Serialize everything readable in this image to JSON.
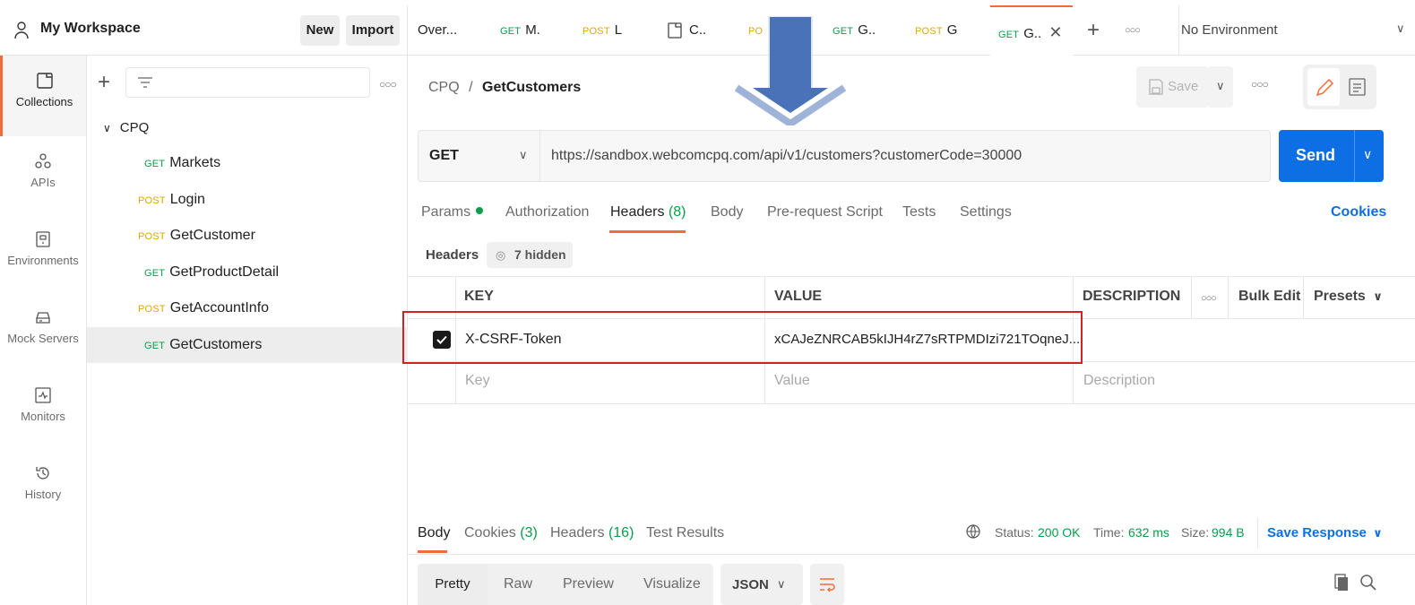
{
  "colors": {
    "accent": "#f26b3a",
    "get": "#0a9d4a",
    "post": "#e0a800",
    "primary": "#0d6fe3",
    "annotation_red": "#d32222",
    "annotation_arrow": "#4a72b8"
  },
  "workspace": {
    "title": "My Workspace",
    "new_label": "New",
    "import_label": "Import",
    "icon": "user-icon"
  },
  "left_nav": [
    {
      "label": "Collections",
      "icon": "collections-icon"
    },
    {
      "label": "APIs",
      "icon": "apis-icon"
    },
    {
      "label": "Environments",
      "icon": "environments-icon"
    },
    {
      "label": "Mock Servers",
      "icon": "mock-servers-icon"
    },
    {
      "label": "Monitors",
      "icon": "monitors-icon"
    },
    {
      "label": "History",
      "icon": "history-icon"
    }
  ],
  "sidebar": {
    "collection": "CPQ",
    "requests": [
      {
        "method": "GET",
        "name": "Markets"
      },
      {
        "method": "POST",
        "name": "Login"
      },
      {
        "method": "POST",
        "name": "GetCustomer"
      },
      {
        "method": "GET",
        "name": "GetProductDetail"
      },
      {
        "method": "POST",
        "name": "GetAccountInfo"
      },
      {
        "method": "GET",
        "name": "GetCustomers"
      }
    ]
  },
  "tabs": [
    {
      "method": "",
      "label": "Over..."
    },
    {
      "method": "GET",
      "label": "M."
    },
    {
      "method": "POST",
      "label": "L"
    },
    {
      "method": "",
      "label": "C.."
    },
    {
      "method": "PO",
      "label": ""
    },
    {
      "method": "GET",
      "label": "G.."
    },
    {
      "method": "POST",
      "label": "G"
    },
    {
      "method": "GET",
      "label": "G.."
    }
  ],
  "environment": "No Environment",
  "request": {
    "breadcrumb_collection": "CPQ",
    "breadcrumb_separator": "/",
    "breadcrumb_name": "GetCustomers",
    "save_label": "Save",
    "method": "GET",
    "url": "https://sandbox.webcomcpq.com/api/v1/customers?customerCode=30000",
    "send_label": "Send",
    "tabs": {
      "params": "Params",
      "authorization": "Authorization",
      "headers": "Headers",
      "headers_count": "(8)",
      "body": "Body",
      "prerequest": "Pre-request Script",
      "tests": "Tests",
      "settings": "Settings"
    },
    "cookies_link": "Cookies",
    "headers_title": "Headers",
    "hidden_label": "7 hidden"
  },
  "headers_table": {
    "columns": {
      "key": "KEY",
      "value": "VALUE",
      "description": "DESCRIPTION",
      "bulk_edit": "Bulk Edit",
      "presets": "Presets"
    },
    "rows": [
      {
        "checked": true,
        "key": "X-CSRF-Token",
        "value": "xCAJeZNRCAB5kIJH4rZ7sRTPMDIzi721TOqneJ..."
      }
    ],
    "placeholder": {
      "key": "Key",
      "value": "Value",
      "description": "Description"
    }
  },
  "response": {
    "tabs": {
      "body": "Body",
      "cookies": "Cookies",
      "cookies_count": "(3)",
      "headers": "Headers",
      "headers_count": "(16)",
      "test_results": "Test Results"
    },
    "status_label": "Status:",
    "status_value": "200 OK",
    "time_label": "Time:",
    "time_value": "632 ms",
    "size_label": "Size:",
    "size_value": "994 B",
    "save_response": "Save Response",
    "view_tabs": {
      "pretty": "Pretty",
      "raw": "Raw",
      "preview": "Preview",
      "visualize": "Visualize"
    },
    "format": "JSON"
  }
}
